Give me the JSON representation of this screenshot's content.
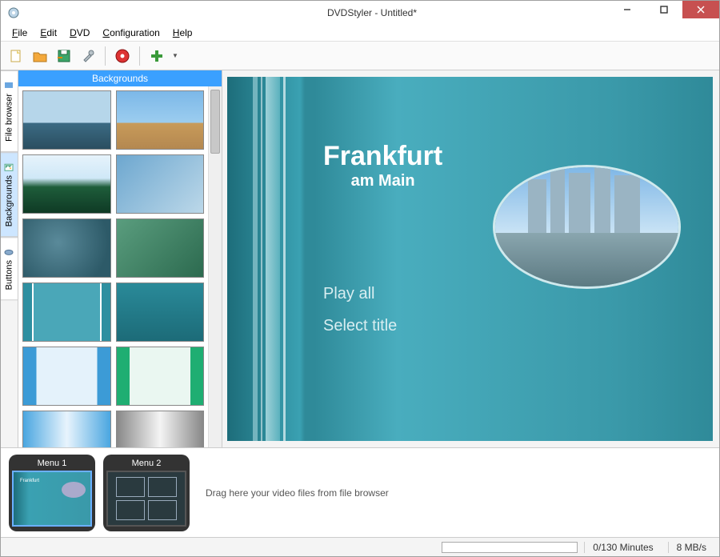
{
  "window": {
    "title": "DVDStyler - Untitled*"
  },
  "menu": {
    "file": "File",
    "edit": "Edit",
    "dvd": "DVD",
    "config": "Configuration",
    "help": "Help"
  },
  "toolbar": {
    "new": "new-project-icon",
    "open": "open-folder-icon",
    "save": "save-icon",
    "settings": "wrench-icon",
    "burn": "burn-disc-icon",
    "add": "add-icon"
  },
  "tabs": {
    "file_browser": "File browser",
    "backgrounds": "Backgrounds",
    "buttons": "Buttons"
  },
  "side": {
    "header": "Backgrounds"
  },
  "preview": {
    "title_main": "Frankfurt",
    "title_sub": "am Main",
    "link_play": "Play all",
    "link_select": "Select title"
  },
  "strip": {
    "menu1": "Menu 1",
    "menu2": "Menu 2",
    "hint": "Drag here your video files from file browser"
  },
  "status": {
    "minutes": "0/130 Minutes",
    "bitrate": "8 MB/s"
  }
}
